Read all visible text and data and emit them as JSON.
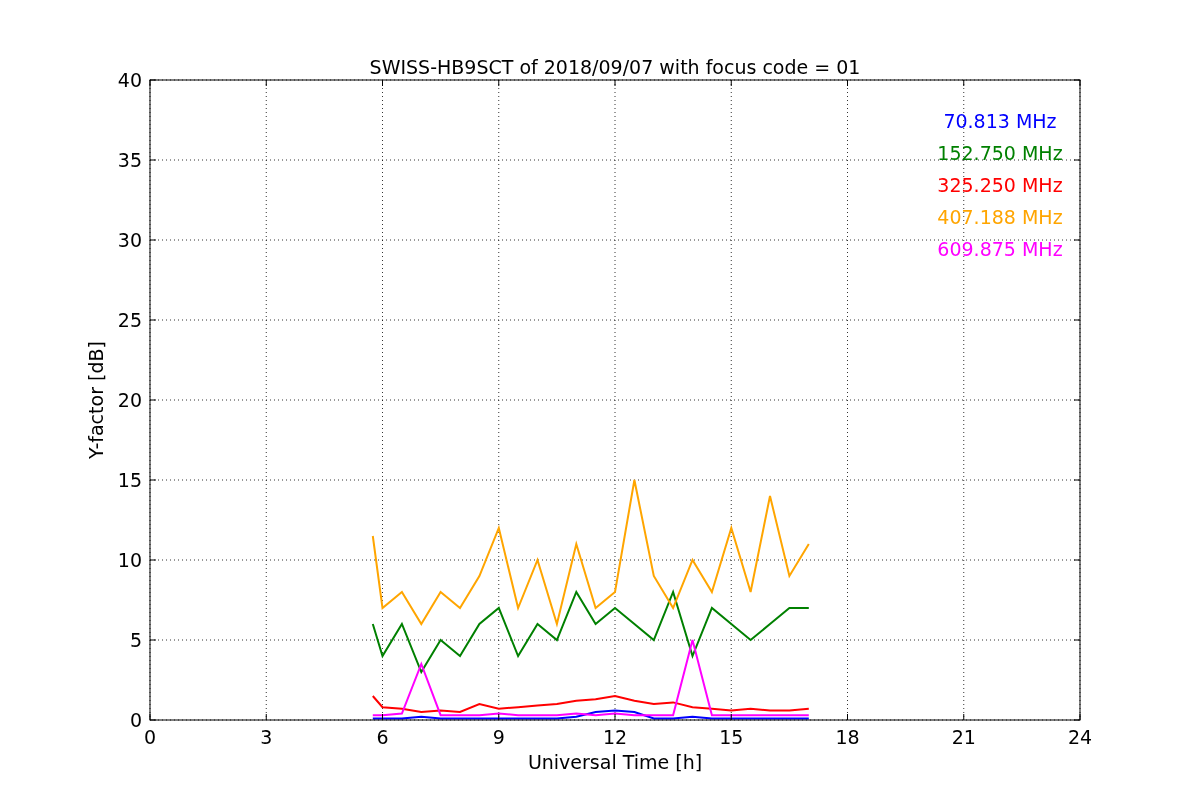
{
  "chart_data": {
    "type": "line",
    "title": "SWISS-HB9SCT of 2018/09/07 with focus code = 01",
    "xlabel": "Universal Time [h]",
    "ylabel": "Y-factor [dB]",
    "x": [
      5.75,
      6,
      6.5,
      7,
      7.5,
      8,
      8.5,
      9,
      9.5,
      10,
      10.5,
      11,
      11.5,
      12,
      12.5,
      13,
      13.5,
      14,
      14.5,
      15,
      15.5,
      16,
      16.5,
      17
    ],
    "series": [
      {
        "name": "70.813 MHz",
        "color": "#0000ff",
        "values": [
          0.1,
          0.1,
          0.1,
          0.2,
          0.1,
          0.1,
          0.1,
          0.1,
          0.1,
          0.1,
          0.1,
          0.2,
          0.5,
          0.6,
          0.5,
          0.1,
          0.1,
          0.2,
          0.1,
          0.1,
          0.1,
          0.1,
          0.1,
          0.1
        ]
      },
      {
        "name": "152.750 MHz",
        "color": "#008000",
        "values": [
          6,
          4,
          6,
          3,
          5,
          4,
          6,
          7,
          4,
          6,
          5,
          8,
          6,
          7,
          6,
          5,
          8,
          4,
          7,
          6,
          5,
          6,
          7,
          7
        ]
      },
      {
        "name": "325.250 MHz",
        "color": "#ff0000",
        "values": [
          1.5,
          0.8,
          0.7,
          0.5,
          0.6,
          0.5,
          1,
          0.7,
          0.8,
          0.9,
          1,
          1.2,
          1.3,
          1.5,
          1.2,
          1,
          1.1,
          0.8,
          0.7,
          0.6,
          0.7,
          0.6,
          0.6,
          0.7
        ]
      },
      {
        "name": "407.188 MHz",
        "color": "#ffa500",
        "values": [
          11.5,
          7,
          8,
          6,
          8,
          7,
          9,
          12,
          7,
          10,
          6,
          11,
          7,
          8,
          15,
          9,
          7,
          10,
          8,
          12,
          8,
          14,
          9,
          11
        ]
      },
      {
        "name": "609.875 MHz",
        "color": "#ff00ff",
        "values": [
          0.3,
          0.3,
          0.4,
          3.5,
          0.3,
          0.3,
          0.3,
          0.4,
          0.3,
          0.3,
          0.3,
          0.4,
          0.3,
          0.4,
          0.3,
          0.3,
          0.3,
          5,
          0.3,
          0.3,
          0.3,
          0.3,
          0.3,
          0.3
        ]
      }
    ],
    "xlim": [
      0,
      24
    ],
    "ylim": [
      0,
      40
    ],
    "xticks": [
      0,
      3,
      6,
      9,
      12,
      15,
      18,
      21,
      24
    ],
    "yticks": [
      0,
      5,
      10,
      15,
      20,
      25,
      30,
      35,
      40
    ],
    "grid": true
  }
}
